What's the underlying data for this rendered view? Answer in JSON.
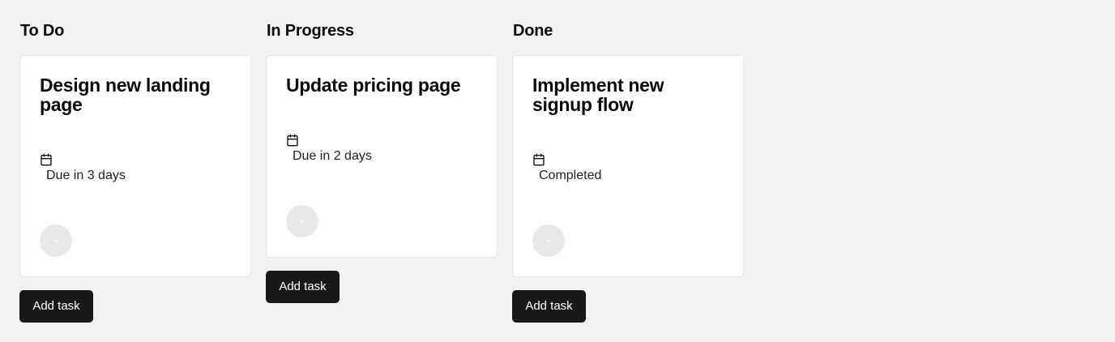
{
  "columns": [
    {
      "title": "To Do",
      "card": {
        "title": "Design new landing page",
        "due_icon": "calendar-icon",
        "due_text": "Due in 3 days"
      },
      "add_label": "Add task"
    },
    {
      "title": "In Progress",
      "card": {
        "title": "Update pricing page",
        "due_icon": "calendar-icon",
        "due_text": "Due in 2 days"
      },
      "add_label": "Add task"
    },
    {
      "title": "Done",
      "card": {
        "title": "Implement new signup flow",
        "due_icon": "calendar-icon",
        "due_text": "Completed"
      },
      "add_label": "Add task"
    }
  ],
  "colors": {
    "background": "#f2f3f5",
    "card": "#ffffff",
    "button": "#18181b",
    "avatar": "#e8e8ea"
  }
}
